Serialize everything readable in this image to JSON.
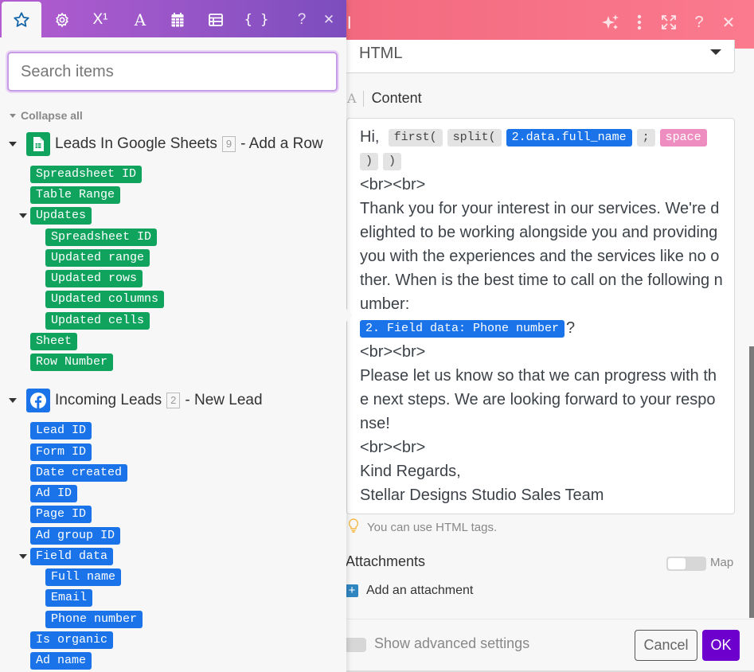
{
  "dialog": {
    "title_partial": "ail",
    "header_icons": [
      "sparkles-icon",
      "more-vertical-icon",
      "expand-icon",
      "help-icon",
      "close-icon"
    ],
    "body_format": {
      "value": "HTML"
    },
    "content_field": {
      "label": "Content",
      "type_icon": "A",
      "greeting": "Hi,",
      "tokens": {
        "first": "first(",
        "split": "split(",
        "full_name": "2.data.full_name",
        "semicolon": ";",
        "space": "space",
        "close1": ")",
        "close2": ")"
      },
      "br1": "<br><br>",
      "paragraph1": "Thank you for your interest in our services. We're delighted to be working alongside you and providing you with the experiences and the services like no other. When is the best time to call on the following number:",
      "phone_token": "2. Field data: Phone number",
      "question_mark": "?",
      "br2": "<br><br>",
      "paragraph2": "Please let us know so that we can progress with the next steps. We are looking forward to your response!",
      "br3": "<br><br>",
      "closing": "Kind Regards,",
      "signature": "Stellar Designs Studio Sales Team"
    },
    "hint": "You can use HTML tags.",
    "attachments": {
      "label": "Attachments",
      "map_label": "Map",
      "map_enabled": false,
      "add_label": "Add an attachment"
    },
    "advanced": {
      "label": "Show advanced settings",
      "enabled": false
    },
    "buttons": {
      "cancel": "Cancel",
      "ok": "OK"
    }
  },
  "panel": {
    "tabs": [
      {
        "name": "favorites",
        "icon": "star-icon",
        "active": true
      },
      {
        "name": "general",
        "icon": "gear-icon"
      },
      {
        "name": "math",
        "icon": "superscript-icon",
        "glyph": "X¹"
      },
      {
        "name": "text",
        "icon": "text-icon",
        "glyph": "A"
      },
      {
        "name": "date",
        "icon": "calendar-icon"
      },
      {
        "name": "array",
        "icon": "table-icon"
      },
      {
        "name": "json",
        "icon": "braces-icon",
        "glyph": "{ }"
      }
    ],
    "help_glyph": "?",
    "close_glyph": "✕",
    "search": {
      "placeholder": "Search items",
      "value": ""
    },
    "collapse_all": "Collapse all",
    "modules": [
      {
        "name": "Leads In Google Sheets",
        "count": "9",
        "action": "- Add a Row",
        "icon": "google-sheets-icon",
        "color": "#10a35e",
        "items": [
          "Spreadsheet ID",
          "Table Range",
          "Updates",
          "Spreadsheet ID",
          "Updated range",
          "Updated rows",
          "Updated columns",
          "Updated cells",
          "Sheet",
          "Row Number"
        ]
      },
      {
        "name": "Incoming Leads",
        "count": "2",
        "action": "- New Lead",
        "icon": "facebook-icon",
        "color": "#1a73e8",
        "items": [
          "Lead ID",
          "Form ID",
          "Date created",
          "Ad ID",
          "Page ID",
          "Ad group ID",
          "Field data",
          "Full name",
          "Email",
          "Phone number",
          "Is organic",
          "Ad name"
        ]
      }
    ]
  }
}
